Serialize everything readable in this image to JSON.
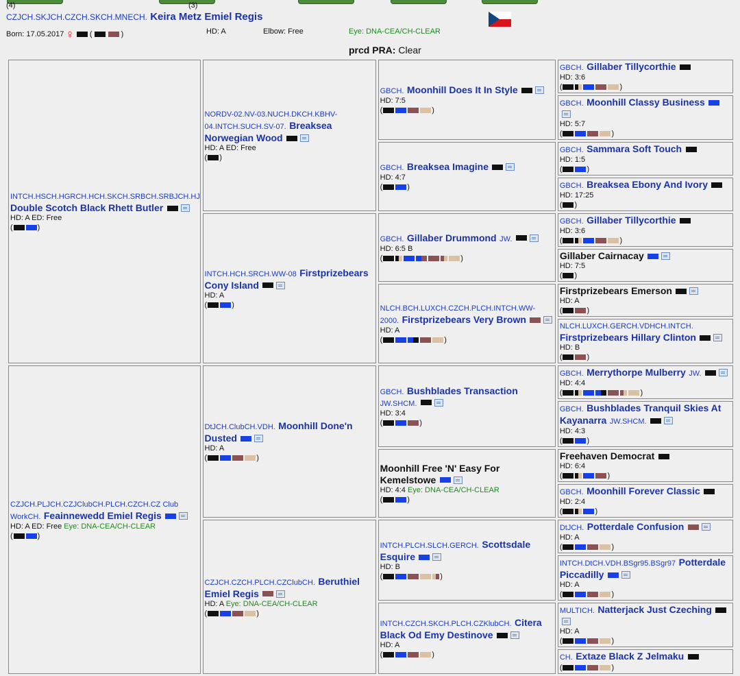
{
  "colors": {
    "black": "#111111",
    "blue": "#1740e6",
    "liver": "#8a5252",
    "cream": "#d9c2a4",
    "brindle_dark": "#3a2a1a",
    "title_blue": "#1a3cc9",
    "name_blue": "#1a33a8",
    "eye_green": "#1e8a1e",
    "female_red": "#e02222"
  },
  "header": {
    "num_left": "(4)",
    "num_right": "(3)",
    "titles": "CZJCH.SKJCH.CZCH.SKCH.MNECH.",
    "name": "Keira Metz Emiel Regis",
    "born": "Born: 17.05.2017",
    "hd": "HD: A",
    "elbow": "Elbow: Free",
    "eye": "Eye: DNA-CEA/CH-CLEAR",
    "pra_label": "prcd PRA:",
    "pra_value": " Clear",
    "flag": "czech-flag"
  },
  "dogs": {
    "g1a": {
      "titles": "INTCH.HSCH.HGRCH.HCH.SKCH.SRBCH.SRBJCH.HJCH.",
      "name": "Double Scotch Black Rhett Butler",
      "info": "HD: A ED: Free"
    },
    "g1b": {
      "titles": "CZJCH.PLJCH.CZJClubCH.PLCH.CZCH.CZ Club WorkCH.",
      "name": "Feainnewedd Emiel Regis",
      "info": "HD: A ED: Free",
      "eye": "Eye: DNA-CEA/CH-CLEAR"
    },
    "g2a": {
      "titles": "NORDV-02.NV-03.NUCH.DKCH.KBHV-04.INTCH.SUCH.SV-07.",
      "name": "Breaksea Norwegian Wood",
      "info": "HD: A ED: Free"
    },
    "g2b": {
      "titles": "INTCH.HCH.SRCH.WW-08",
      "name": "Firstprizebears Cony Island",
      "info": "HD: A"
    },
    "g2c": {
      "titles": "DtJCH.ClubCH.VDH.",
      "name": "Moonhill Done'n Dusted",
      "info": "HD: A"
    },
    "g2d": {
      "titles": "CZJCH.CZCH.PLCH.CZClubCH.",
      "name": "Beruthiel Emiel Regis",
      "info": "HD: A",
      "eye": "Eye: DNA-CEA/CH-CLEAR"
    },
    "g3a": {
      "titles": "GBCH.",
      "name": "Moonhill Does It In Style",
      "info": "HD: 7:5"
    },
    "g3b": {
      "titles": "GBCH.",
      "name": "Breaksea Imagine",
      "info": "HD: 4:7"
    },
    "g3c": {
      "titles": "GBCH.",
      "name": "Gillaber Drummond",
      "suffix": "JW.",
      "info": "HD: 6:5 B"
    },
    "g3d": {
      "titles": "NLCH.BCH.LUXCH.CZCH.PLCH.INTCH.WW-2000.",
      "name": "Firstprizebears Very Brown",
      "info": "HD: A"
    },
    "g3e": {
      "titles": "GBCH.",
      "name": "Bushblades Transaction",
      "suffix": "JW.SHCM.",
      "info": "HD: 3:4"
    },
    "g3f": {
      "titles": "",
      "name": "Moonhill Free 'N' Easy For Kemelstowe",
      "info": "HD: 4:4",
      "eye": "Eye: DNA-CEA/CH-CLEAR"
    },
    "g3g": {
      "titles": "INTCH.PLCH.SLCH.GERCH.",
      "name": "Scottsdale Esquire",
      "info": "HD: B"
    },
    "g3h": {
      "titles": "INTCH.CZCH.SKCH.PLCH.CZKlubCH.",
      "name": "Citera Black Od Emy Destinove",
      "info": "HD: A"
    },
    "g4a": {
      "titles": "GBCH.",
      "name": "Gillaber Tillycorthie",
      "info": "HD: 3:6"
    },
    "g4b": {
      "titles": "GBCH.",
      "name": "Moonhill Classy Business",
      "info": "HD: 5:7"
    },
    "g4c": {
      "titles": "GBCH.",
      "name": "Sammara Soft Touch",
      "info": "HD: 1:5"
    },
    "g4d": {
      "titles": "GBCH.",
      "name": "Breaksea Ebony And Ivory",
      "info": "HD: 17:25"
    },
    "g4e": {
      "titles": "GBCH.",
      "name": "Gillaber Tillycorthie",
      "info": "HD: 3:6"
    },
    "g4f": {
      "titles": "",
      "name": "Gillaber Cairnacay",
      "info": "HD: 7:5"
    },
    "g4g": {
      "titles": "",
      "name": "Firstprizebears Emerson",
      "info": "HD: A"
    },
    "g4h": {
      "titles": "NLCH.LUXCH.GERCH.VDHCH.INTCH.",
      "name": "Firstprizebears Hillary Clinton",
      "info": "HD: B"
    },
    "g4i": {
      "titles": "GBCH.",
      "name": "Merrythorpe Mulberry",
      "suffix": "JW.",
      "info": "HD: 4:4"
    },
    "g4j": {
      "titles": "GBCH.",
      "name": "Bushblades Tranquil Skies At Kayanarra",
      "suffix": "JW.SHCM.",
      "info": "HD: 4:3"
    },
    "g4k": {
      "titles": "",
      "name": "Freehaven Democrat",
      "info": "HD: 6:4"
    },
    "g4l": {
      "titles": "GBCH.",
      "name": "Moonhill Forever Classic",
      "info": "HD: 2:4"
    },
    "g4m": {
      "titles": "DtJCH.",
      "name": "Potterdale Confusion",
      "info": "HD: A"
    },
    "g4n": {
      "titles": "INTCH.DtCH.VDH.BSgr95.BSgr97",
      "name": "Potterdale Piccadilly",
      "info": "HD: A"
    },
    "g4o": {
      "titles": "MULTICH.",
      "name": "Natterjack Just Czeching",
      "info": "HD: A"
    },
    "g4p": {
      "titles": "CH.",
      "name": "Extaze Black Z Jelmaku",
      "info": ""
    }
  }
}
